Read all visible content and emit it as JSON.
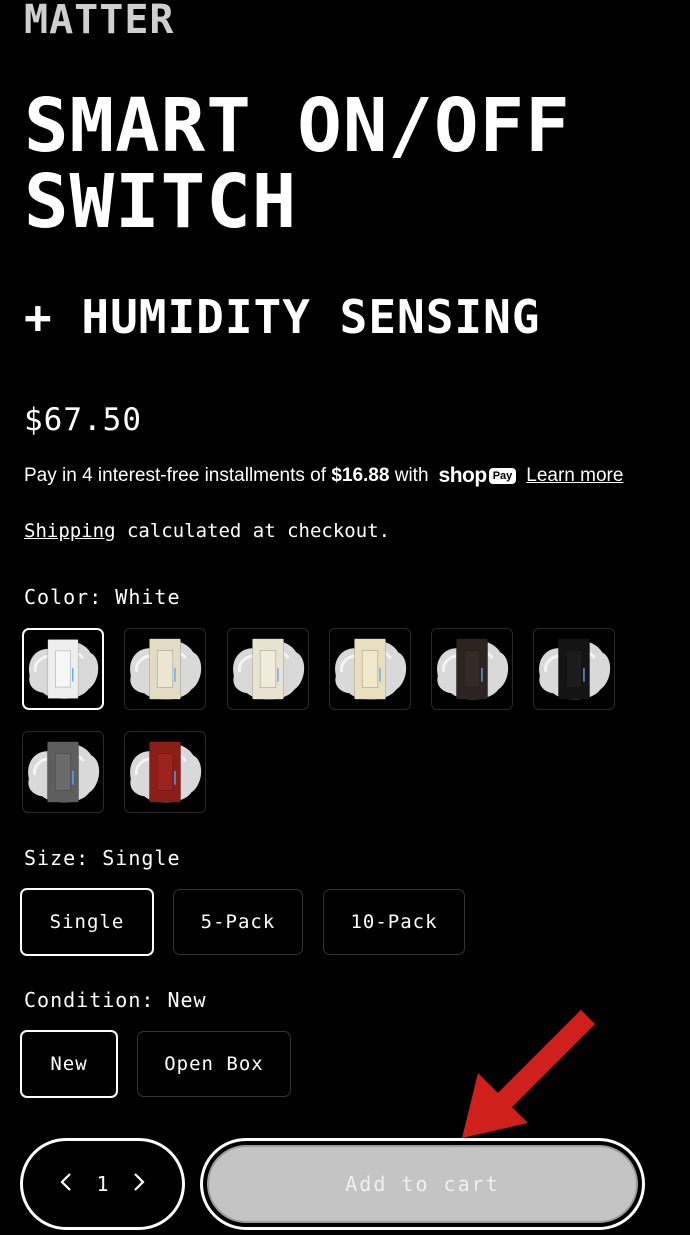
{
  "brand": "MATTER",
  "title": "SMART ON/OFF SWITCH",
  "subtitle": "+ HUMIDITY SENSING",
  "price": "$67.50",
  "installments": {
    "prefix": "Pay in 4 interest-free installments of ",
    "amount": "$16.88",
    "suffix": " with",
    "shop_logo": "shop",
    "pay_badge": "Pay",
    "learn_more": "Learn more"
  },
  "shipping": {
    "link": "Shipping",
    "text": " calculated at checkout."
  },
  "color": {
    "label": "Color: White",
    "swatches": [
      {
        "name": "White",
        "plate": "#eeeeee",
        "rocker": "#f6f6f6",
        "selected": true
      },
      {
        "name": "Light Almond",
        "plate": "#e3dcc4",
        "rocker": "#ece6d0",
        "selected": false
      },
      {
        "name": "Almond",
        "plate": "#e8e3d0",
        "rocker": "#f0ebda",
        "selected": false
      },
      {
        "name": "Ivory",
        "plate": "#e9dfbf",
        "rocker": "#f1e8cc",
        "selected": false
      },
      {
        "name": "Brown",
        "plate": "#2b2420",
        "rocker": "#342b26",
        "selected": false
      },
      {
        "name": "Black",
        "plate": "#141414",
        "rocker": "#1c1c1c",
        "selected": false
      },
      {
        "name": "Gray",
        "plate": "#5e5e5e",
        "rocker": "#6a6a6a",
        "selected": false
      },
      {
        "name": "Red",
        "plate": "#8c1e18",
        "rocker": "#9c2420",
        "selected": false
      }
    ]
  },
  "size": {
    "label": "Size: Single",
    "options": [
      "Single",
      "5-Pack",
      "10-Pack"
    ],
    "selected": "Single"
  },
  "condition": {
    "label": "Condition: New",
    "options": [
      "New",
      "Open Box"
    ],
    "selected": "New"
  },
  "quantity": {
    "value": "1",
    "decrease_icon": "chevron-left-icon",
    "increase_icon": "chevron-right-icon"
  },
  "add_to_cart": "Add to cart",
  "annotation": {
    "color": "#d0201c"
  }
}
